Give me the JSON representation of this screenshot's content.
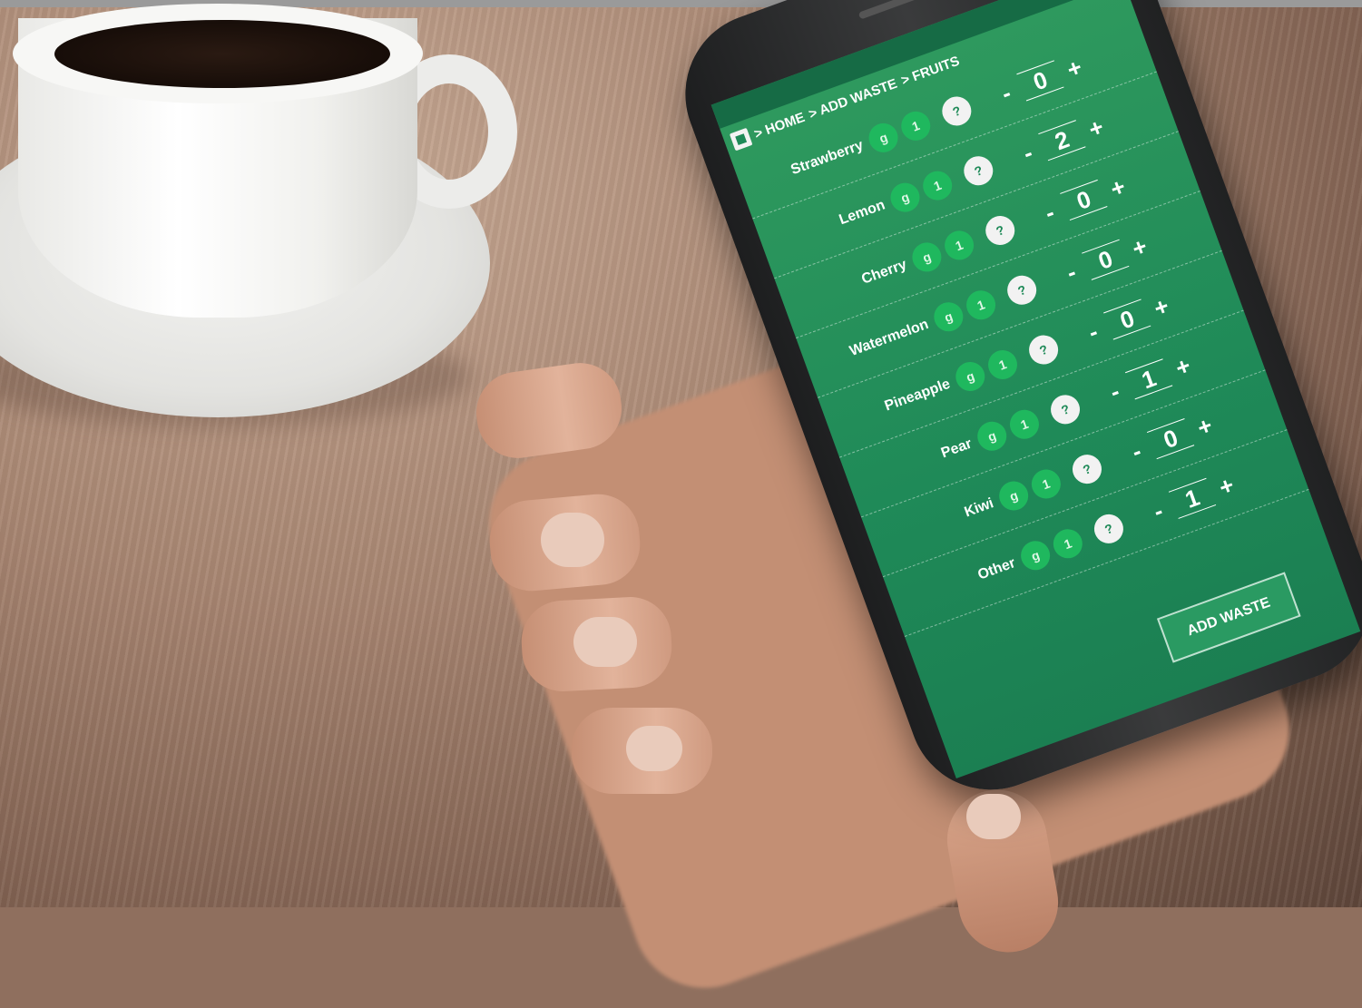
{
  "breadcrumb": {
    "home": "> HOME",
    "add": "> ADD WASTE",
    "fruits": "> FRUITS"
  },
  "rows": [
    {
      "name": "Strawberry",
      "unit_g": "g",
      "unit_1": "1",
      "help": "?",
      "minus": "-",
      "qty": "0",
      "plus": "+"
    },
    {
      "name": "Lemon",
      "unit_g": "g",
      "unit_1": "1",
      "help": "?",
      "minus": "-",
      "qty": "2",
      "plus": "+"
    },
    {
      "name": "Cherry",
      "unit_g": "g",
      "unit_1": "1",
      "help": "?",
      "minus": "-",
      "qty": "0",
      "plus": "+"
    },
    {
      "name": "Watermelon",
      "unit_g": "g",
      "unit_1": "1",
      "help": "?",
      "minus": "-",
      "qty": "0",
      "plus": "+"
    },
    {
      "name": "Pineapple",
      "unit_g": "g",
      "unit_1": "1",
      "help": "?",
      "minus": "-",
      "qty": "0",
      "plus": "+"
    },
    {
      "name": "Pear",
      "unit_g": "g",
      "unit_1": "1",
      "help": "?",
      "minus": "-",
      "qty": "1",
      "plus": "+"
    },
    {
      "name": "Kiwi",
      "unit_g": "g",
      "unit_1": "1",
      "help": "?",
      "minus": "-",
      "qty": "0",
      "plus": "+"
    },
    {
      "name": "Other",
      "unit_g": "g",
      "unit_1": "1",
      "help": "?",
      "minus": "-",
      "qty": "1",
      "plus": "+"
    }
  ],
  "add_button": "ADD WASTE",
  "colors": {
    "screen_green": "#1f8a58",
    "unit_green": "#1fb85e",
    "help_white": "#f2f2f2"
  }
}
